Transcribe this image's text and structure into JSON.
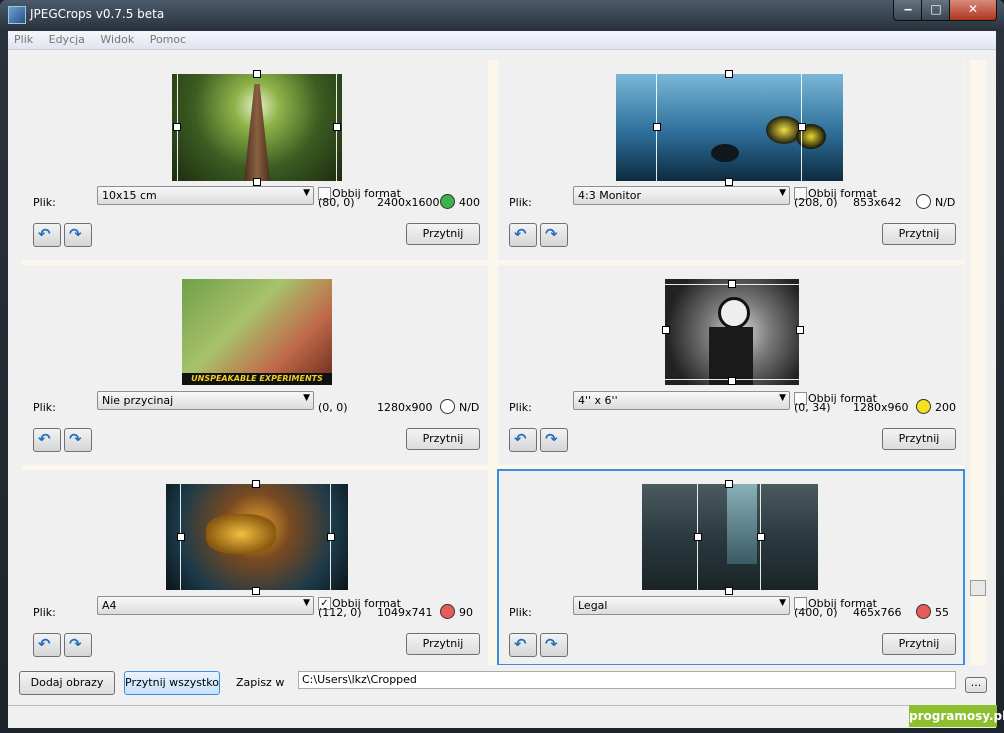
{
  "window": {
    "title": "JPEGCrops v0.7.5 beta"
  },
  "menu": [
    "Plik",
    "Edycja",
    "Widok",
    "Pomoc"
  ],
  "panels": [
    {
      "file_label": "Plik:",
      "format": "10x15 cm",
      "flip_label": "Obbij format",
      "flip_checked": false,
      "offset": "(80, 0)",
      "size": "2400x1600",
      "dpi": "400",
      "status_color": "#3bb34a",
      "crop_label": "Przytnij"
    },
    {
      "file_label": "Plik:",
      "format": "4:3 Monitor",
      "flip_label": "Obbij format",
      "flip_checked": false,
      "offset": "(208, 0)",
      "size": "853x642",
      "dpi": "N/D",
      "status_color": "#ffffff",
      "crop_label": "Przytnij"
    },
    {
      "file_label": "Plik:",
      "format": "Nie przycinaj",
      "flip_label": "",
      "flip_checked": false,
      "offset": "(0, 0)",
      "size": "1280x900",
      "dpi": "N/D",
      "status_color": "#ffffff",
      "crop_label": "Przytnij",
      "image_caption": "UNSPEAKABLE EXPERIMENTS"
    },
    {
      "file_label": "Plik:",
      "format": "4'' x 6''",
      "flip_label": "Obbij format",
      "flip_checked": false,
      "offset": "(0, 34)",
      "size": "1280x960",
      "dpi": "200",
      "status_color": "#f2e21b",
      "crop_label": "Przytnij"
    },
    {
      "file_label": "Plik:",
      "format": "A4",
      "flip_label": "Obbij format",
      "flip_checked": true,
      "offset": "(112, 0)",
      "size": "1049x741",
      "dpi": "90",
      "status_color": "#e85b5b",
      "crop_label": "Przytnij"
    },
    {
      "file_label": "Plik:",
      "format": "Legal",
      "flip_label": "Obbij format",
      "flip_checked": false,
      "offset": "(400, 0)",
      "size": "465x766",
      "dpi": "55",
      "status_color": "#e85b5b",
      "crop_label": "Przytnij"
    }
  ],
  "bottom": {
    "add_images": "Dodaj obrazy",
    "crop_all": "Przytnij wszystko",
    "save_in": "Zapisz w",
    "path": "C:\\Users\\lkz\\Cropped",
    "browse": "..."
  },
  "watermark": "programosy.pl"
}
